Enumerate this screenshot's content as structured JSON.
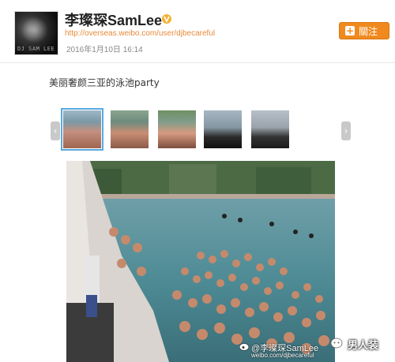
{
  "header": {
    "username": "李璨琛SamLee",
    "verified_icon": "verified-v-icon",
    "url": "http://overseas.weibo.com/user/djbecareful",
    "date": "2016年1月10日 16:14",
    "follow_label": "關注",
    "avatar_text": "DJ SAM LEE"
  },
  "post": {
    "text": "美丽奢颜三亚的泳池party"
  },
  "gallery": {
    "prev_icon": "chevron-left-icon",
    "next_icon": "chevron-right-icon",
    "thumbnail_count": 5,
    "selected_index": 0
  },
  "watermark": {
    "handle": "@李璨琛SamLee",
    "url": "weibo.com/djbecareful",
    "brand": "男人装"
  },
  "colors": {
    "accent": "#f08a1f",
    "link": "#e8893a",
    "selected_outline": "#58a9e0"
  }
}
